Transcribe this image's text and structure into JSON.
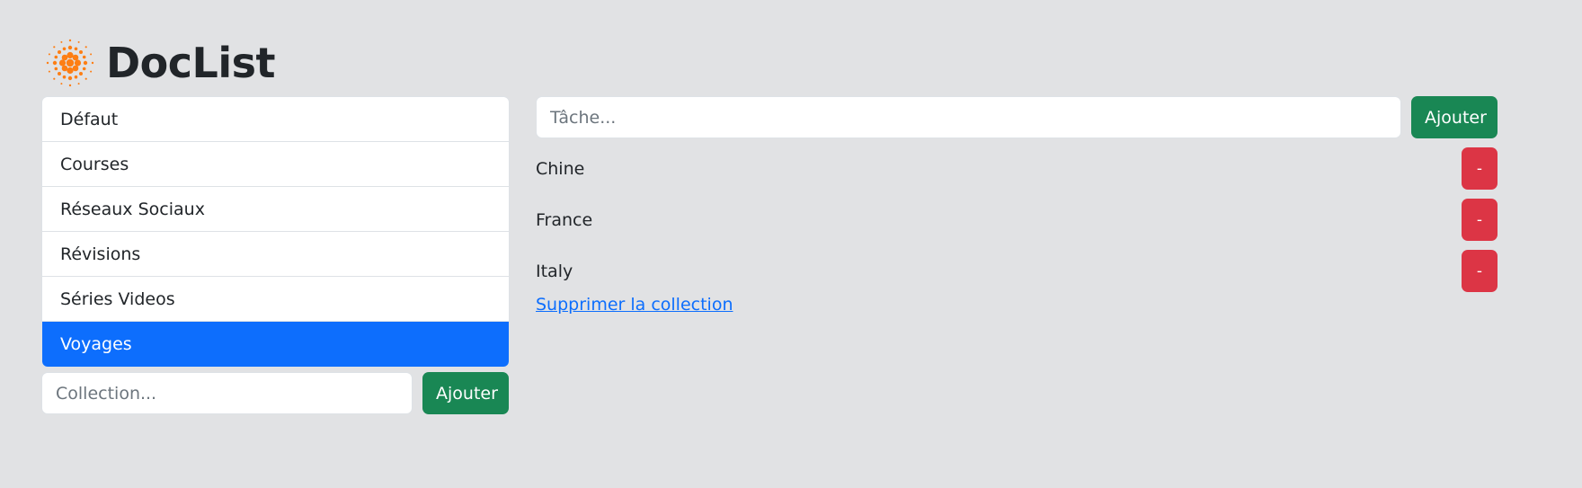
{
  "app": {
    "title": "DocList",
    "logo_icon": "sunburst-icon",
    "logo_color": "#fd7e14"
  },
  "collections": {
    "items": [
      {
        "label": "Défaut",
        "active": false
      },
      {
        "label": "Courses",
        "active": false
      },
      {
        "label": "Réseaux Sociaux",
        "active": false
      },
      {
        "label": "Révisions",
        "active": false
      },
      {
        "label": "Séries Videos",
        "active": false
      },
      {
        "label": "Voyages",
        "active": true
      }
    ],
    "new_placeholder": "Collection...",
    "add_label": "Ajouter"
  },
  "tasks": {
    "new_placeholder": "Tâche...",
    "add_label": "Ajouter",
    "items": [
      {
        "label": "Chine",
        "delete_label": "-"
      },
      {
        "label": "France",
        "delete_label": "-"
      },
      {
        "label": "Italy",
        "delete_label": "-"
      }
    ],
    "delete_collection_label": "Supprimer la collection"
  },
  "colors": {
    "background": "#e1e2e4",
    "active": "#0d6efd",
    "success": "#198754",
    "danger": "#dc3545",
    "link": "#0d6efd"
  }
}
